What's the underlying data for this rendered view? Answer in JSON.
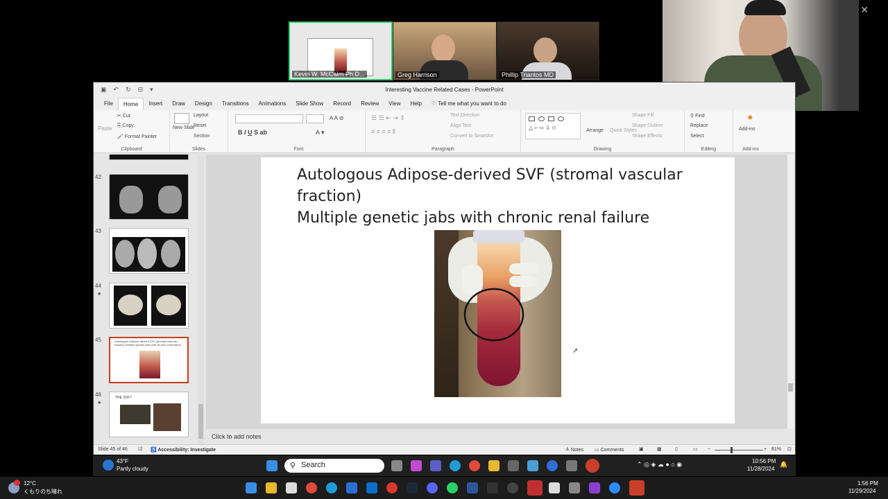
{
  "zoom": {
    "participants": [
      {
        "name": "Kevin W. McCairn Ph.D..."
      },
      {
        "name": "Greg Harrison"
      },
      {
        "name": "Phillip Triantos MD"
      }
    ]
  },
  "ppt": {
    "window_title": "Interesting Vaccine Related Cases  -  PowerPoint",
    "tabs": [
      "File",
      "Home",
      "Insert",
      "Draw",
      "Design",
      "Transitions",
      "Animations",
      "Slide Show",
      "Record",
      "Review",
      "View",
      "Help"
    ],
    "tell_me": "Tell me what you want to do",
    "ribbon": {
      "clipboard": {
        "paste": "Paste",
        "cut": "Cut",
        "copy": "Copy",
        "format_painter": "Format Painter",
        "label": "Clipboard"
      },
      "slides": {
        "new_slide": "New Slide",
        "layout": "Layout",
        "reset": "Reset",
        "section": "Section",
        "label": "Slides"
      },
      "font": {
        "label": "Font"
      },
      "paragraph": {
        "text_direction": "Text Direction",
        "align_text": "Align Text",
        "smartart": "Convert to SmartArt",
        "label": "Paragraph"
      },
      "drawing": {
        "arrange": "Arrange",
        "quick_styles": "Quick Styles",
        "shape_fill": "Shape Fill",
        "shape_outline": "Shape Outline",
        "shape_effects": "Shape Effects",
        "label": "Drawing"
      },
      "editing": {
        "find": "Find",
        "replace": "Replace",
        "select": "Select",
        "label": "Editing"
      },
      "addins": {
        "addins": "Add-ins",
        "label": "Add-ins"
      }
    },
    "thumbnails": [
      {
        "num": "42",
        "star": ""
      },
      {
        "num": "43",
        "star": ""
      },
      {
        "num": "44",
        "star": "★"
      },
      {
        "num": "45",
        "star": ""
      },
      {
        "num": "46",
        "star": "★"
      }
    ],
    "thumb_45_text": "Autologous Adipose-derived SVF (stromal vascular fraction) Multiple genetic jabs with chronic renal failure",
    "thumb_46_text": "THE SVF?",
    "slide": {
      "title_line1": "Autologous Adipose-derived SVF (stromal vascular fraction)",
      "title_line2": "Multiple genetic jabs with chronic renal failure"
    },
    "notes_placeholder": "Click to add notes",
    "status": {
      "slide_count": "Slide 45 of 46",
      "accessibility": "Accessibility: Investigate",
      "notes": "Notes",
      "comments": "Comments",
      "zoom": "81%"
    }
  },
  "taskbar_inner": {
    "weather_temp": "43°F",
    "weather_desc": "Partly cloudy",
    "search": "Search",
    "time": "10:56 PM",
    "date": "11/28/2024"
  },
  "taskbar_outer": {
    "weather_temp": "12°C",
    "weather_desc": "くもりのち晴れ",
    "time": "1:56 PM",
    "date": "11/29/2024"
  }
}
